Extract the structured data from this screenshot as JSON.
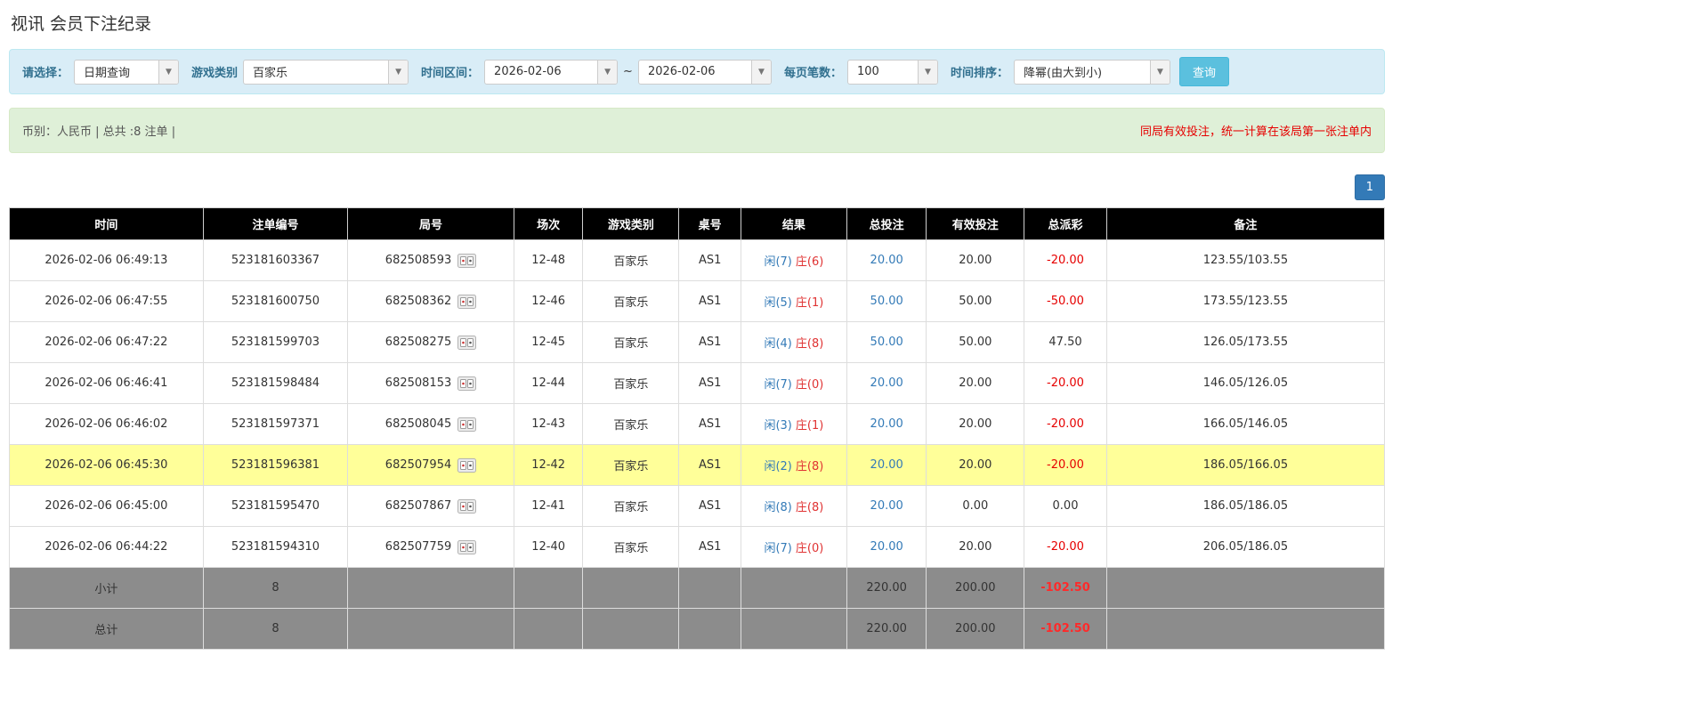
{
  "page": {
    "title": "视讯 会员下注纪录"
  },
  "icons": {
    "caret_down": "▼"
  },
  "filters": {
    "select_label": "请选择：",
    "select_value": "日期查询",
    "game_type_label": "游戏类别",
    "game_type_value": "百家乐",
    "time_range_label": "时间区间：",
    "date_from": "2026-02-06",
    "tilde": "~",
    "date_to": "2026-02-06",
    "page_size_label": "每页笔数：",
    "page_size_value": "100",
    "sort_label": "时间排序：",
    "sort_value": "降幂(由大到小)",
    "search_button": "查询"
  },
  "summary": {
    "left": "币别：人民币 | 总共 :8 注单 |",
    "right": "同局有效投注，统一计算在该局第一张注单内"
  },
  "pagination": {
    "current_page": "1"
  },
  "table": {
    "headers": [
      "时间",
      "注单编号",
      "局号",
      "场次",
      "游戏类别",
      "桌号",
      "结果",
      "总投注",
      "有效投注",
      "总派彩",
      "备注"
    ],
    "rows": [
      {
        "time": "2026-02-06 06:49:13",
        "bet_id": "523181603367",
        "round_id": "682508593",
        "session": "12-48",
        "game": "百家乐",
        "table_no": "AS1",
        "result_player": "闲(7)",
        "result_banker": "庄(6)",
        "total_bet": "20.00",
        "valid_bet": "20.00",
        "payout": "-20.00",
        "note": "123.55/103.55",
        "highlighted": false
      },
      {
        "time": "2026-02-06 06:47:55",
        "bet_id": "523181600750",
        "round_id": "682508362",
        "session": "12-46",
        "game": "百家乐",
        "table_no": "AS1",
        "result_player": "闲(5)",
        "result_banker": "庄(1)",
        "total_bet": "50.00",
        "valid_bet": "50.00",
        "payout": "-50.00",
        "note": "173.55/123.55",
        "highlighted": false
      },
      {
        "time": "2026-02-06 06:47:22",
        "bet_id": "523181599703",
        "round_id": "682508275",
        "session": "12-45",
        "game": "百家乐",
        "table_no": "AS1",
        "result_player": "闲(4)",
        "result_banker": "庄(8)",
        "total_bet": "50.00",
        "valid_bet": "50.00",
        "payout": "47.50",
        "note": "126.05/173.55",
        "highlighted": false
      },
      {
        "time": "2026-02-06 06:46:41",
        "bet_id": "523181598484",
        "round_id": "682508153",
        "session": "12-44",
        "game": "百家乐",
        "table_no": "AS1",
        "result_player": "闲(7)",
        "result_banker": "庄(0)",
        "total_bet": "20.00",
        "valid_bet": "20.00",
        "payout": "-20.00",
        "note": "146.05/126.05",
        "highlighted": false
      },
      {
        "time": "2026-02-06 06:46:02",
        "bet_id": "523181597371",
        "round_id": "682508045",
        "session": "12-43",
        "game": "百家乐",
        "table_no": "AS1",
        "result_player": "闲(3)",
        "result_banker": "庄(1)",
        "total_bet": "20.00",
        "valid_bet": "20.00",
        "payout": "-20.00",
        "note": "166.05/146.05",
        "highlighted": false
      },
      {
        "time": "2026-02-06 06:45:30",
        "bet_id": "523181596381",
        "round_id": "682507954",
        "session": "12-42",
        "game": "百家乐",
        "table_no": "AS1",
        "result_player": "闲(2)",
        "result_banker": "庄(8)",
        "total_bet": "20.00",
        "valid_bet": "20.00",
        "payout": "-20.00",
        "note": "186.05/166.05",
        "highlighted": true
      },
      {
        "time": "2026-02-06 06:45:00",
        "bet_id": "523181595470",
        "round_id": "682507867",
        "session": "12-41",
        "game": "百家乐",
        "table_no": "AS1",
        "result_player": "闲(8)",
        "result_banker": "庄(8)",
        "total_bet": "20.00",
        "valid_bet": "0.00",
        "payout": "0.00",
        "note": "186.05/186.05",
        "highlighted": false
      },
      {
        "time": "2026-02-06 06:44:22",
        "bet_id": "523181594310",
        "round_id": "682507759",
        "session": "12-40",
        "game": "百家乐",
        "table_no": "AS1",
        "result_player": "闲(7)",
        "result_banker": "庄(0)",
        "total_bet": "20.00",
        "valid_bet": "20.00",
        "payout": "-20.00",
        "note": "206.05/186.05",
        "highlighted": false
      }
    ],
    "subtotal": {
      "label": "小计",
      "count": "8",
      "total_bet": "220.00",
      "valid_bet": "200.00",
      "payout": "-102.50"
    },
    "total": {
      "label": "总计",
      "count": "8",
      "total_bet": "220.00",
      "valid_bet": "200.00",
      "payout": "-102.50"
    }
  }
}
